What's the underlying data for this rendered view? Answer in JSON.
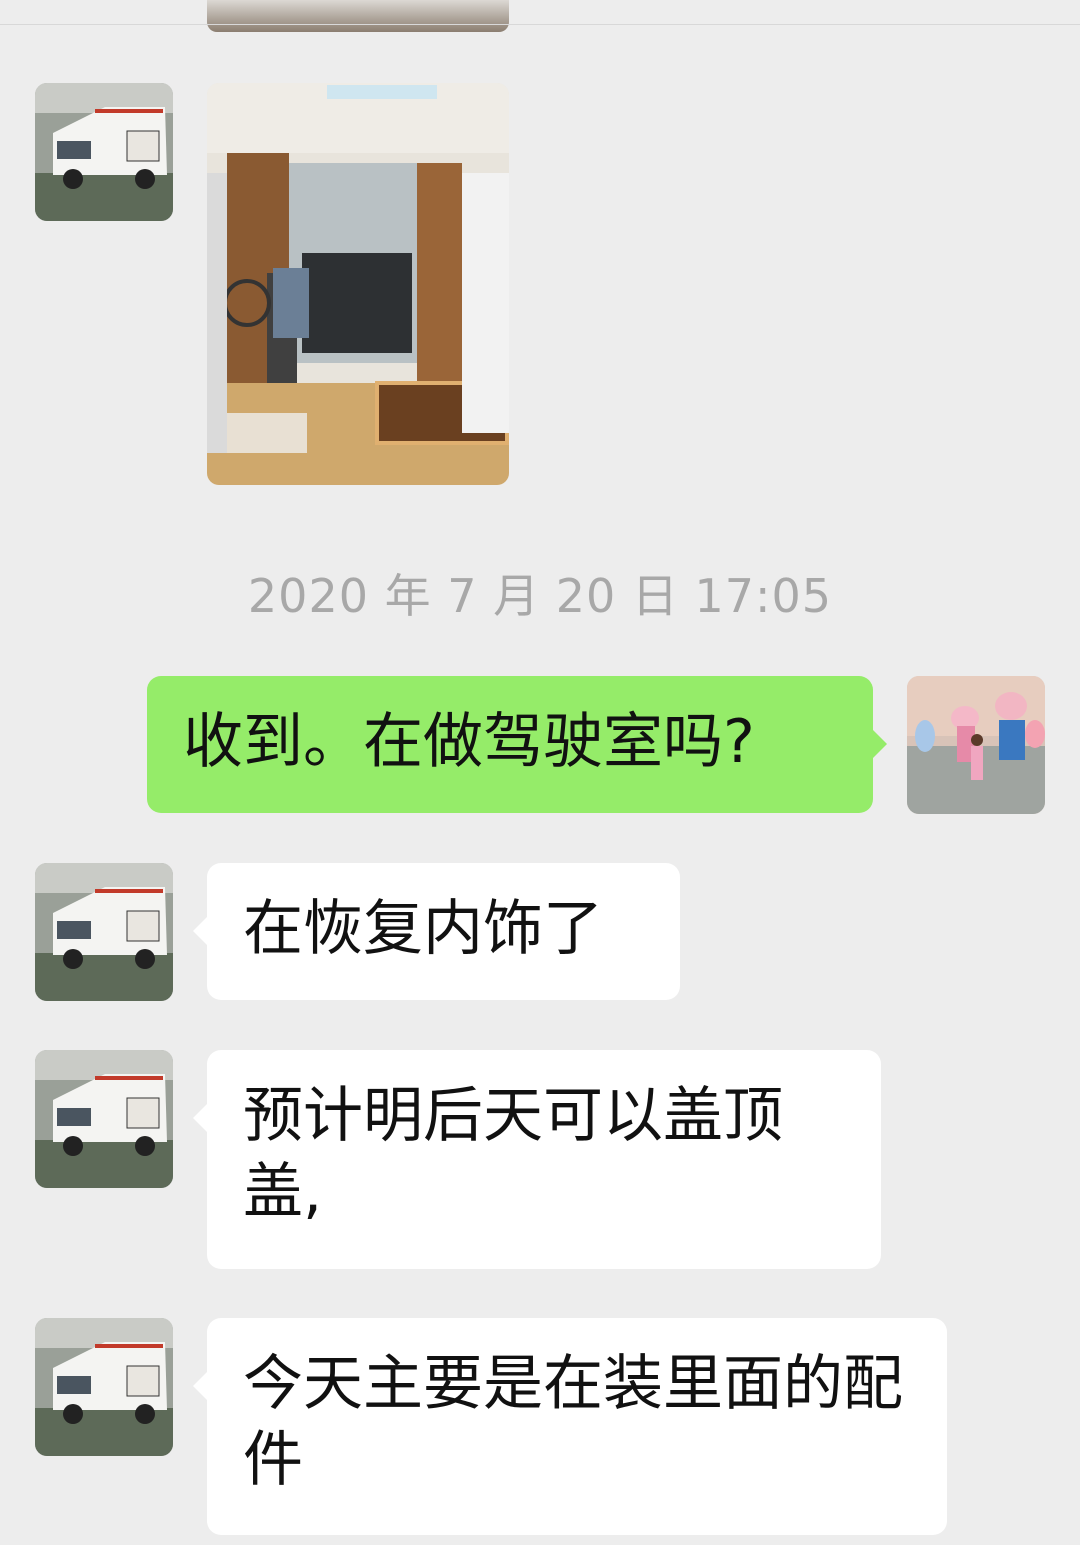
{
  "chat": {
    "timestamp": "2020 年 7 月 20 日 17:05",
    "colors": {
      "background": "#ededed",
      "incoming_bubble": "#ffffff",
      "outgoing_bubble": "#95ec69",
      "timestamp_text": "#a8a8a8"
    },
    "messages": [
      {
        "side": "incoming",
        "type": "image",
        "image_icon": "rv-interior-photo"
      },
      {
        "side": "outgoing",
        "type": "text",
        "text": "收到。在做驾驶室吗?"
      },
      {
        "side": "incoming",
        "type": "text",
        "text": "在恢复内饰了"
      },
      {
        "side": "incoming",
        "type": "text",
        "text": "预计明后天可以盖顶盖,"
      },
      {
        "side": "incoming",
        "type": "text",
        "text": "今天主要是在装里面的配件"
      }
    ],
    "avatars": {
      "contact": "rv-camper-avatar",
      "self": "child-with-statues-avatar"
    }
  }
}
